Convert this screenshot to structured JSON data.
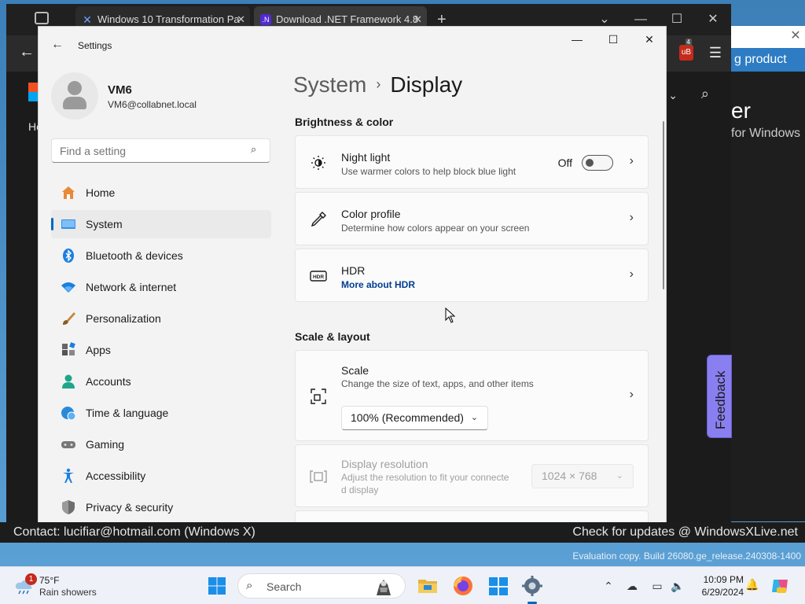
{
  "browser": {
    "tabs": [
      {
        "label": "Windows 10 Transformation Pa",
        "favicon": "x-logo-icon"
      },
      {
        "label": "Download .NET Framework 4.8",
        "favicon": "dotnet-icon"
      }
    ],
    "page_link": "Ho"
  },
  "background_page": {
    "banner": "g product",
    "heading": "er",
    "subheading": "for Windows",
    "feedback_label": "Feedback"
  },
  "desktop": {
    "contact": "Contact: lucifiar@hotmail.com (Windows X)",
    "updates": "Check for updates @ WindowsXLive.net",
    "evaluation": "Evaluation copy. Build 26080.ge_release.240308-1400"
  },
  "settings": {
    "window_title": "Settings",
    "user": {
      "name": "VM6",
      "email": "VM6@collabnet.local"
    },
    "search_placeholder": "Find a setting",
    "nav": [
      {
        "label": "Home",
        "icon": "home-icon"
      },
      {
        "label": "System",
        "icon": "system-icon",
        "active": true
      },
      {
        "label": "Bluetooth & devices",
        "icon": "bluetooth-icon"
      },
      {
        "label": "Network & internet",
        "icon": "wifi-icon"
      },
      {
        "label": "Personalization",
        "icon": "brush-icon"
      },
      {
        "label": "Apps",
        "icon": "apps-icon"
      },
      {
        "label": "Accounts",
        "icon": "accounts-icon"
      },
      {
        "label": "Time & language",
        "icon": "globe-clock-icon"
      },
      {
        "label": "Gaming",
        "icon": "gamepad-icon"
      },
      {
        "label": "Accessibility",
        "icon": "accessibility-icon"
      },
      {
        "label": "Privacy & security",
        "icon": "shield-icon"
      }
    ],
    "breadcrumb": {
      "parent": "System",
      "separator": "›",
      "current": "Display"
    },
    "sections": {
      "brightness": "Brightness & color",
      "scale_layout": "Scale & layout"
    },
    "cards": {
      "night_light": {
        "title": "Night light",
        "sub": "Use warmer colors to help block blue light",
        "toggle_label": "Off",
        "toggle_on": false
      },
      "color_profile": {
        "title": "Color profile",
        "sub": "Determine how colors appear on your screen"
      },
      "hdr": {
        "title": "HDR",
        "link": "More about HDR"
      },
      "scale": {
        "title": "Scale",
        "sub": "Change the size of text, apps, and other items",
        "value": "100% (Recommended)"
      },
      "resolution": {
        "title": "Display resolution",
        "sub1": "Adjust the resolution to fit your connecte",
        "sub2": "d display",
        "value": "1024 × 768"
      }
    }
  },
  "taskbar": {
    "weather": {
      "temp": "75°F",
      "condition": "Rain showers",
      "badge": "1"
    },
    "search_label": "Search",
    "time": "10:09 PM",
    "date": "6/29/2024",
    "ext_badge": "4",
    "ext_text": "uB"
  },
  "colors": {
    "accent": "#0067c0",
    "link": "#003e92",
    "feedback": "#8a7ff0"
  }
}
